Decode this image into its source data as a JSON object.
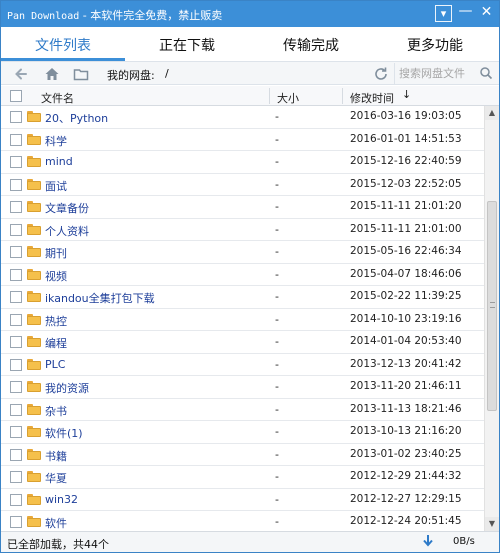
{
  "window": {
    "title_en": "Pan Download",
    "title_cn": " - 本软件完全免费，禁止贩卖",
    "colors": {
      "accent": "#3c8fd8",
      "link": "#1e3f9a",
      "folder": "#f5c04b"
    }
  },
  "title_buttons": {
    "menu": "▾",
    "minimize": "—",
    "close": "✕"
  },
  "tabs": [
    {
      "label": "文件列表",
      "active": true
    },
    {
      "label": "正在下载",
      "active": false
    },
    {
      "label": "传输完成",
      "active": false
    },
    {
      "label": "更多功能",
      "active": false
    }
  ],
  "toolbar": {
    "back_icon": "arrow-left-icon",
    "home_icon": "home-icon",
    "folder_icon": "folder-icon",
    "path_label": "我的网盘:",
    "path_value": "/",
    "refresh_icon": "refresh-icon",
    "search_placeholder": "搜索网盘文件",
    "search_icon": "search-icon"
  },
  "columns": {
    "name": "文件名",
    "size": "大小",
    "time": "修改时间",
    "sort_indicator": "↓"
  },
  "files": [
    {
      "name": "20、Python",
      "size": "-",
      "time": "2016-03-16 19:03:05"
    },
    {
      "name": "科学",
      "size": "-",
      "time": "2016-01-01 14:51:53"
    },
    {
      "name": "mind",
      "size": "-",
      "time": "2015-12-16 22:40:59"
    },
    {
      "name": "面试",
      "size": "-",
      "time": "2015-12-03 22:52:05"
    },
    {
      "name": "文章备份",
      "size": "-",
      "time": "2015-11-11 21:01:20"
    },
    {
      "name": "个人资料",
      "size": "-",
      "time": "2015-11-11 21:01:00"
    },
    {
      "name": "期刊",
      "size": "-",
      "time": "2015-05-16 22:46:34"
    },
    {
      "name": "视频",
      "size": "-",
      "time": "2015-04-07 18:46:06"
    },
    {
      "name": "ikandou全集打包下载",
      "size": "-",
      "time": "2015-02-22 11:39:25"
    },
    {
      "name": "热控",
      "size": "-",
      "time": "2014-10-10 23:19:16"
    },
    {
      "name": "编程",
      "size": "-",
      "time": "2014-01-04 20:53:40"
    },
    {
      "name": "PLC",
      "size": "-",
      "time": "2013-12-13 20:41:42"
    },
    {
      "name": "我的资源",
      "size": "-",
      "time": "2013-11-20 21:46:11"
    },
    {
      "name": "杂书",
      "size": "-",
      "time": "2013-11-13 18:21:46"
    },
    {
      "name": "软件(1)",
      "size": "-",
      "time": "2013-10-13 21:16:20"
    },
    {
      "name": "书籍",
      "size": "-",
      "time": "2013-01-02 23:40:25"
    },
    {
      "name": "华夏",
      "size": "-",
      "time": "2012-12-29 21:44:32"
    },
    {
      "name": "win32",
      "size": "-",
      "time": "2012-12-27 12:29:15"
    },
    {
      "name": "软件",
      "size": "-",
      "time": "2012-12-24 20:51:45"
    }
  ],
  "status": {
    "text": "已全部加载，共44个",
    "download_icon": "download-arrow-icon",
    "speed": "0B/s"
  }
}
